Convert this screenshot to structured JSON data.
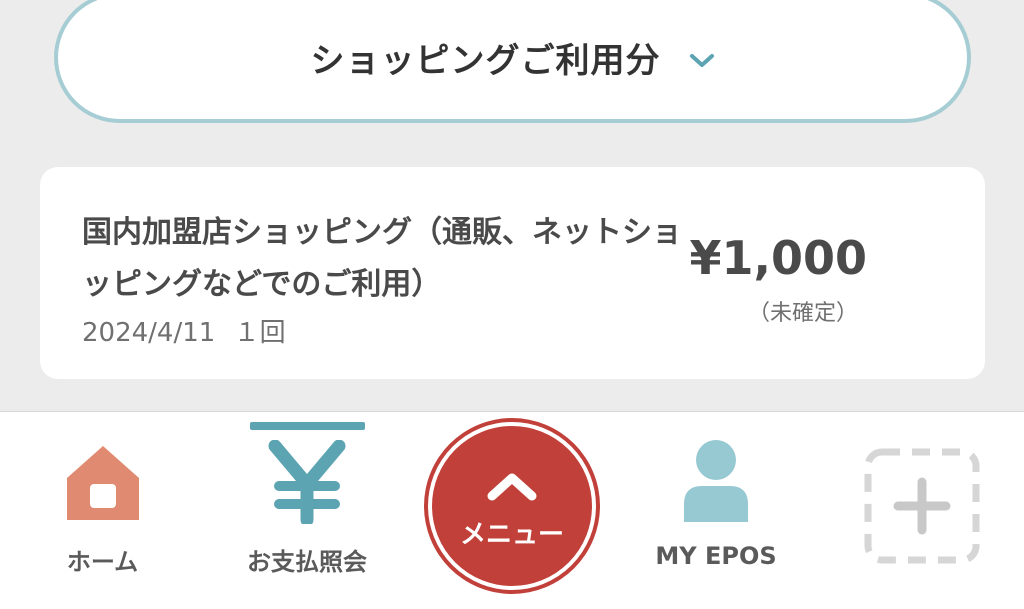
{
  "filter": {
    "label": "ショッピングご利用分"
  },
  "card": {
    "title": "国内加盟店ショッピング（通販、ネットショッピングなどでのご利用）",
    "date": "2024/4/11",
    "count": "１回",
    "amount": "¥1,000",
    "status": "（未確定）"
  },
  "tabbar": {
    "home": "ホーム",
    "payment": "お支払照会",
    "menu": "メニュー",
    "myepos": "MY EPOS"
  },
  "colors": {
    "accent": "#5ca4b2",
    "home_icon": "#e08a72",
    "menu_red": "#c2403a",
    "person_icon": "#96c9d2",
    "pill_border": "#a5cdd3"
  },
  "icons": {
    "filter": "chevron-down-icon",
    "home": "house-icon",
    "payment": "yen-icon",
    "menu": "chevron-up-icon",
    "myepos": "person-icon",
    "add": "plus-icon"
  }
}
